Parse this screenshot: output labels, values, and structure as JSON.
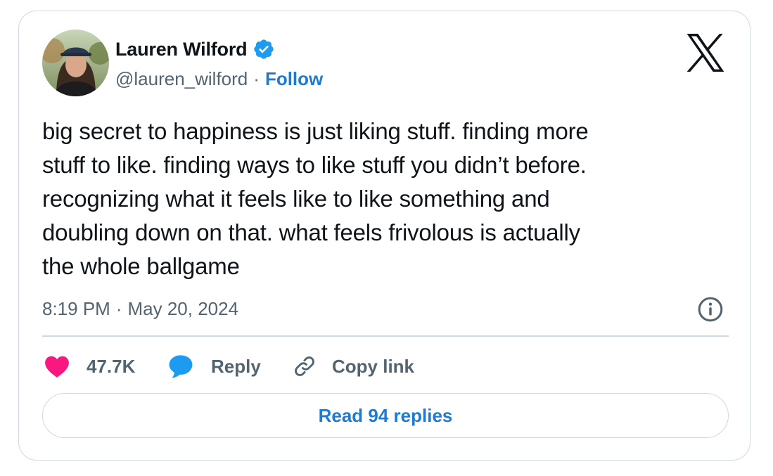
{
  "author": {
    "display_name": "Lauren Wilford",
    "handle": "@lauren_wilford",
    "separator": "·",
    "follow_label": "Follow",
    "verified": true
  },
  "tweet": {
    "text": "big secret to happiness is just liking stuff.  finding more\nstuff to like. finding ways to like stuff you didn’t before.\nrecognizing what it feels like to like something and\ndoubling down on that. what feels frivolous is actually\nthe whole ballgame",
    "time": "8:19 PM",
    "date_separator": "·",
    "date": "May 20, 2024"
  },
  "actions": {
    "like_count": "47.7K",
    "reply_label": "Reply",
    "copy_link_label": "Copy link"
  },
  "read_replies_label": "Read 94 replies",
  "icons": {
    "verified": "verified-badge-icon",
    "logo": "x-logo-icon",
    "info": "info-icon",
    "like": "heart-icon",
    "reply": "speech-bubble-icon",
    "copy": "link-icon"
  },
  "colors": {
    "text": "#0f1419",
    "muted": "#536471",
    "link": "#1d7bd2",
    "verified": "#1d9bf0",
    "heart": "#f91880",
    "border": "#cfd9de"
  }
}
